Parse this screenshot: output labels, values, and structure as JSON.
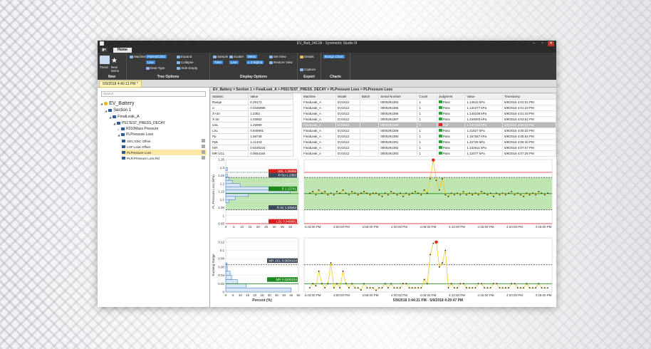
{
  "window": {
    "title": "EV_Batt_0412A - Symmetric Studio III",
    "min": "–",
    "max": "▫",
    "close": "✕"
  },
  "ribbon": {
    "menu_tab": "▮▾",
    "home_tab": "Home",
    "new_group": {
      "trend": "Trend",
      "new_items": "New\nItems",
      "label": "New"
    },
    "tree_options": {
      "machines": "Machines",
      "parent_child": "Parent/Child",
      "line": "Line",
      "data_type": "Data Type",
      "expand": "Expand",
      "collapse": "Collapse",
      "hide_empty": "Hide Empty",
      "label": "Tree Options"
    },
    "display_options": {
      "sample": "Sample",
      "scatter": "Scatter",
      "mean": "Mean",
      "time": "Time",
      "line": "Line",
      "sigma": "± 3 Sigma",
      "set_view": "Set View",
      "restore_view": "Restore View",
      "label": "Display Options"
    },
    "export": {
      "details": "Details",
      "capture": "Capture",
      "label": "Export"
    },
    "charts": {
      "range_chart": "Range Chart",
      "label": "Charts"
    }
  },
  "doc_tab": "5/9/2018 4:40:13 PM *",
  "search": {
    "placeholder": "Search"
  },
  "tree": [
    {
      "label": "EV_Battery",
      "level": 0
    },
    {
      "label": "Section 1",
      "level": 1
    },
    {
      "label": "FinalLeak_A",
      "level": 2
    },
    {
      "label": "P517EST_PRESS_DECAY",
      "level": 3
    },
    {
      "label": "R010Mass Pressure",
      "level": 4
    },
    {
      "label": "PLPressure Loss",
      "level": 4
    },
    {
      "label": "XDC:XDC Offset",
      "level": 5
    },
    {
      "label": "LOF:Leak Offset",
      "level": 5
    },
    {
      "label": "PLPressure Loss",
      "level": 5
    },
    {
      "label": "PLR:Pressure Loss Rd",
      "level": 5
    }
  ],
  "breadcrumb": "EV_Battery > Section 1 > FinalLeak_A > P5517EST_PRESS_DECAY > PLPressure Loss > PLPressure Loss",
  "stats": {
    "headers": [
      "Statistic",
      "Value"
    ],
    "rows": [
      [
        "Range",
        "0.29173"
      ],
      [
        "σ",
        "0.0335986"
      ],
      [
        "X̄+3σ",
        "1.2382"
      ],
      [
        "X̄-3σ",
        "1.03662"
      ],
      [
        "USL",
        "1.26999"
      ],
      [
        "LSL",
        "0.949991"
      ],
      [
        "Pp",
        "1.58748"
      ],
      [
        "Ppk",
        "1.21343"
      ],
      [
        "IXR",
        "0.0230234"
      ],
      [
        "MR UCL",
        "0.0654164"
      ]
    ]
  },
  "table": {
    "headers": [
      "Machine",
      "Model",
      "Batch",
      "Serial Number",
      "Count",
      "Judgment",
      "Value",
      "Timestamp"
    ],
    "rows": [
      [
        "FinalLeak_A",
        "EV3412",
        "",
        "0000292384",
        "1",
        "Pass",
        "1.14515 kPa",
        "5/9/2018 4:01:01 PM"
      ],
      [
        "FinalLeak_A",
        "EV3412",
        "",
        "0000292385",
        "1",
        "Pass",
        "1.134377 kPa",
        "5/9/2018 4:01:23 PM"
      ],
      [
        "FinalLeak_A",
        "EV3412",
        "",
        "0000292386",
        "1",
        "Pass",
        "1.140158 kPa",
        "5/9/2018 4:01:43 PM"
      ],
      [
        "FinalLeak_A",
        "EV3412",
        "",
        "0000292387",
        "1",
        "Pass",
        "1.230093 kPa",
        "5/9/2018 4:03:51 PM"
      ],
      [
        "FinalLeak_A",
        "EV3412",
        "",
        "0000292388",
        "1",
        "Fail",
        "1.347153 kPa",
        "5/9/2018 4:05:03 PM"
      ],
      [
        "FinalLeak_A",
        "EV3412",
        "",
        "0000292389",
        "1",
        "Pass",
        "1.21827 kPa",
        "5/9/2018 4:05:32 PM"
      ],
      [
        "FinalLeak_A",
        "EV3412",
        "",
        "0000292390",
        "1",
        "Pass",
        "1.157557 kPa",
        "5/9/2018 4:05:54 PM"
      ],
      [
        "FinalLeak_A",
        "EV3412",
        "",
        "0000292391",
        "1",
        "Pass",
        "1.22726 kPa",
        "5/9/2018 4:06:40 PM"
      ],
      [
        "FinalLeak_A",
        "EV3412",
        "",
        "0000292392",
        "1",
        "Pass",
        "1.132611 kPa",
        "5/9/2018 4:07:07 PM"
      ],
      [
        "FinalLeak_A",
        "EV3412",
        "",
        "0000292393",
        "1",
        "Pass",
        "1.12077 kPa",
        "5/9/2018 4:07:26 PM"
      ]
    ]
  },
  "colors": {
    "usl": "#d62020",
    "mean": "#1e8a1e",
    "band": "#bfe6b2",
    "hist": "#4d83c9",
    "line": "#f0c000",
    "point": "#222222",
    "outlier": "#e52020"
  },
  "chart_data": [
    {
      "type": "bar",
      "orientation": "horizontal",
      "ylabel": "PL:Pressure Loss (kPa)",
      "xlabel": "",
      "ylim": [
        0.95,
        1.35
      ],
      "xlim": [
        0,
        45
      ],
      "yticks": [
        "1.35",
        "1.3",
        "1.25",
        "1.2",
        "1.15",
        "1.1",
        "1.05",
        "1",
        "0.95"
      ],
      "xticks": [
        "0",
        "5",
        "10",
        "15",
        "20",
        "25",
        "30",
        "35",
        "40"
      ],
      "bins": [
        1.09,
        1.11,
        1.13,
        1.15,
        1.17,
        1.19,
        1.21,
        1.23,
        1.25,
        1.29
      ],
      "values": [
        2,
        6,
        14,
        40,
        30,
        9,
        4,
        2,
        1,
        1
      ],
      "lines": {
        "USL": 1.26999,
        "X+3s": 1.2382,
        "mean": 1.13741,
        "X-3s": 1.03662,
        "LSL": 0.949991
      },
      "labels": {
        "usl": "USL 1.26999",
        "plus3": "X̄+3σ 1.2382",
        "mean": "X̄ 1.13741",
        "minus3": "X̄-3σ 1.03662",
        "lsl": "LSL 0.949991"
      }
    },
    {
      "type": "line",
      "ylim": [
        0.95,
        1.35
      ],
      "xticks": [
        "3:43:00 PM",
        "3:50:00 PM",
        "3:55:00 PM",
        "4:00:00 PM",
        "4:05:00 PM",
        "4:10:00 PM",
        "4:15:00 PM",
        "4:20:00 PM",
        "4:25:00 PM"
      ],
      "values": [
        1.14,
        1.15,
        1.13,
        1.16,
        1.14,
        1.15,
        1.13,
        1.14,
        1.13,
        1.15,
        1.14,
        1.16,
        1.14,
        1.13,
        1.15,
        1.14,
        1.13,
        1.14,
        1.15,
        1.14,
        1.13,
        1.14,
        1.14,
        1.13,
        1.12,
        1.14,
        1.13,
        1.15,
        1.14,
        1.13,
        1.14,
        1.12,
        1.14,
        1.13,
        1.14,
        1.15,
        1.14,
        1.13,
        1.16,
        1.14,
        1.23,
        1.347,
        1.22,
        1.16,
        1.23,
        1.13,
        1.12,
        1.14,
        1.13,
        1.14,
        1.13,
        1.15,
        1.13,
        1.14,
        1.13,
        1.14,
        1.13,
        1.15,
        1.14,
        1.13,
        1.14,
        1.12,
        1.14,
        1.13,
        1.14,
        1.13,
        1.14,
        1.15,
        1.13,
        1.14,
        1.13,
        1.12,
        1.14,
        1.13,
        1.14,
        1.13,
        1.15,
        1.14,
        1.13,
        1.14
      ],
      "outlier_index": 41
    },
    {
      "type": "bar",
      "orientation": "horizontal",
      "ylabel": "Running Range",
      "xlabel": "Percent (%)",
      "ylim": [
        0,
        0.13
      ],
      "xlim": [
        0,
        50
      ],
      "yticks": [
        "0.12",
        "0.1",
        "0.08",
        "0.06",
        "0.04",
        "0.02",
        "0"
      ],
      "xticks": [
        "0",
        "5",
        "10",
        "15",
        "20",
        "25",
        "30",
        "35",
        "40",
        "45",
        "50"
      ],
      "bins": [
        0.01,
        0.02,
        0.03,
        0.04,
        0.05,
        0.06,
        0.07
      ],
      "values": [
        45,
        14,
        8,
        4,
        3,
        1,
        1
      ],
      "lines": {
        "MR UCL": 0.0654164,
        "MR": 0.0200234
      },
      "labels": {
        "ucl": "MR UCL 0.0654164",
        "mr": "MR 0.0200234"
      }
    },
    {
      "type": "line",
      "ylim": [
        0,
        0.13
      ],
      "xlabel": "5/9/2018 3:44:21 PM - 5/9/2018 4:29:47 PM",
      "xticks": [
        "3:43:00 PM",
        "3:50:00 PM",
        "3:55:00 PM",
        "4:00:00 PM",
        "4:05:00 PM",
        "4:10:00 PM",
        "4:15:00 PM",
        "4:20:00 PM",
        "4:25:00 PM"
      ],
      "values": [
        0.01,
        0.02,
        0.015,
        0.05,
        0.02,
        0.01,
        0.02,
        0.07,
        0.01,
        0.02,
        0.01,
        0.05,
        0.02,
        0.01,
        0.02,
        0.01,
        0.01,
        0.005,
        0.02,
        0.01,
        0.01,
        0.01,
        0.004,
        0.01,
        0.01,
        0.02,
        0.01,
        0.02,
        0.01,
        0.01,
        0.01,
        0.02,
        0.02,
        0.01,
        0.01,
        0.01,
        0.01,
        0.01,
        0.03,
        0.02,
        0.09,
        0.117,
        0.12,
        0.06,
        0.07,
        0.1,
        0.01,
        0.02,
        0.01,
        0.01,
        0.02,
        0.02,
        0.01,
        0.01,
        0.01,
        0.01,
        0.02,
        0.02,
        0.01,
        0.01,
        0.01,
        0.02,
        0.02,
        0.01,
        0.01,
        0.01,
        0.01,
        0.02,
        0.02,
        0.01,
        0.01,
        0.01,
        0.02,
        0.01,
        0.01,
        0.01,
        0.02,
        0.01,
        0.01,
        0.01
      ],
      "outlier_index": 42
    }
  ]
}
